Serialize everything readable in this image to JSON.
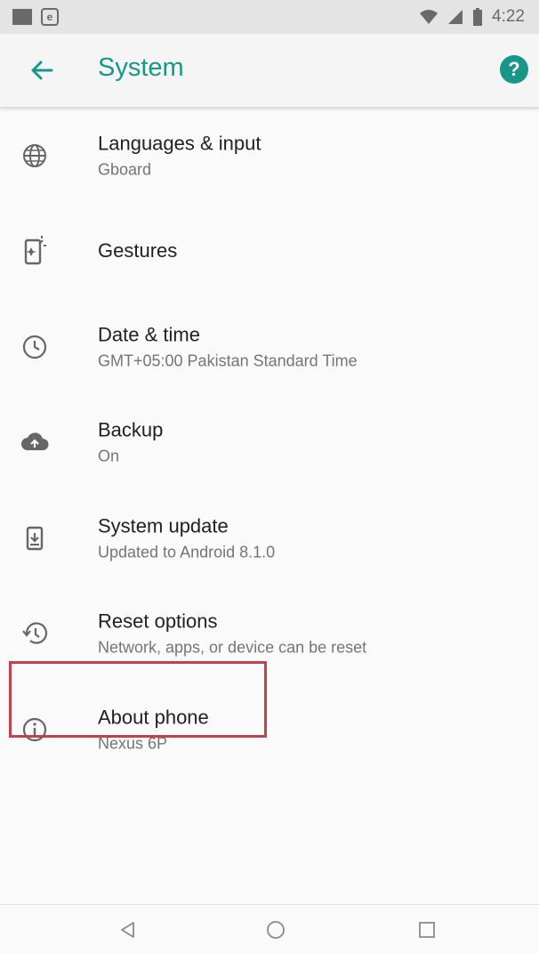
{
  "status_bar": {
    "time": "4:22"
  },
  "app_bar": {
    "title": "System"
  },
  "items": [
    {
      "title": "Languages & input",
      "subtitle": "Gboard"
    },
    {
      "title": "Gestures",
      "subtitle": ""
    },
    {
      "title": "Date & time",
      "subtitle": "GMT+05:00 Pakistan Standard Time"
    },
    {
      "title": "Backup",
      "subtitle": "On"
    },
    {
      "title": "System update",
      "subtitle": "Updated to Android 8.1.0"
    },
    {
      "title": "Reset options",
      "subtitle": "Network, apps, or device can be reset"
    },
    {
      "title": "About phone",
      "subtitle": "Nexus 6P"
    }
  ],
  "icons": {
    "status": [
      "notification-square-icon",
      "e-icon",
      "wifi-icon",
      "signal-icon",
      "battery-icon"
    ],
    "items": [
      "globe-icon",
      "gestures-icon",
      "clock-icon",
      "cloud-upload-icon",
      "system-update-icon",
      "reset-icon",
      "info-icon"
    ],
    "nav": [
      "back-icon",
      "home-icon",
      "recents-icon"
    ]
  },
  "colors": {
    "accent": "#16978a",
    "highlight": "#c0424c"
  }
}
